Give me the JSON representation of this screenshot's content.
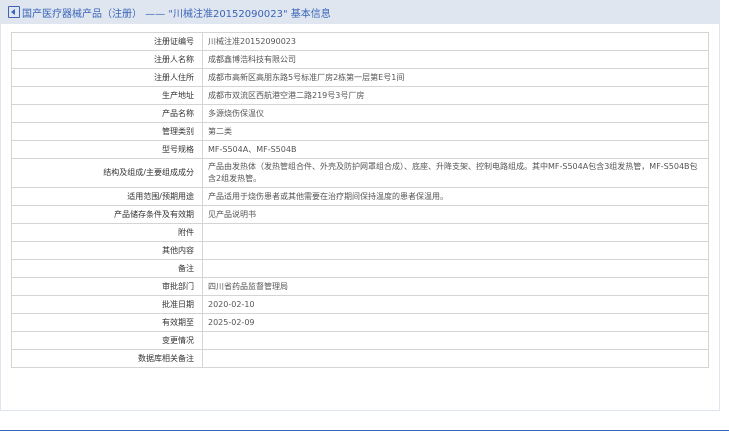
{
  "header": {
    "title": "国产医疗器械产品（注册） —— \"川械注准20152090023\" 基本信息"
  },
  "rows": [
    {
      "label": "注册证编号",
      "value": "川械注准20152090023"
    },
    {
      "label": "注册人名称",
      "value": "成都鑫博浩科技有限公司"
    },
    {
      "label": "注册人住所",
      "value": "成都市高新区高朋东路5号标准厂房2栋第一层第E号1间"
    },
    {
      "label": "生产地址",
      "value": "成都市双流区西航港空港二路219号3号厂房"
    },
    {
      "label": "产品名称",
      "value": "多源烧伤保温仪"
    },
    {
      "label": "管理类别",
      "value": "第二类"
    },
    {
      "label": "型号规格",
      "value": "MF-S504A、MF-S504B"
    },
    {
      "label": "结构及组成/主要组成成分",
      "value": "产品由发热体（发热管组合件、外壳及防护网罩组合成）、底座、升降支架、控制电路组成。其中MF-S504A包含3组发热管，MF-S504B包含2组发热管。"
    },
    {
      "label": "适用范围/预期用途",
      "value": "产品适用于烧伤患者或其他需要在治疗期间保持温度的患者保温用。"
    },
    {
      "label": "产品储存条件及有效期",
      "value": "见产品说明书"
    },
    {
      "label": "附件",
      "value": ""
    },
    {
      "label": "其他内容",
      "value": ""
    },
    {
      "label": "备注",
      "value": ""
    },
    {
      "label": "审批部门",
      "value": "四川省药品监督管理局"
    },
    {
      "label": "批准日期",
      "value": "2020-02-10"
    },
    {
      "label": "有效期至",
      "value": "2025-02-09"
    },
    {
      "label": "变更情况",
      "value": ""
    },
    {
      "label": "数据库相关备注",
      "value": ""
    }
  ],
  "colors": {
    "header_bg": "#dfe6f0",
    "accent": "#3a64b7",
    "border": "#d5d5d5"
  },
  "icons": {
    "header_icon": "back-icon"
  }
}
